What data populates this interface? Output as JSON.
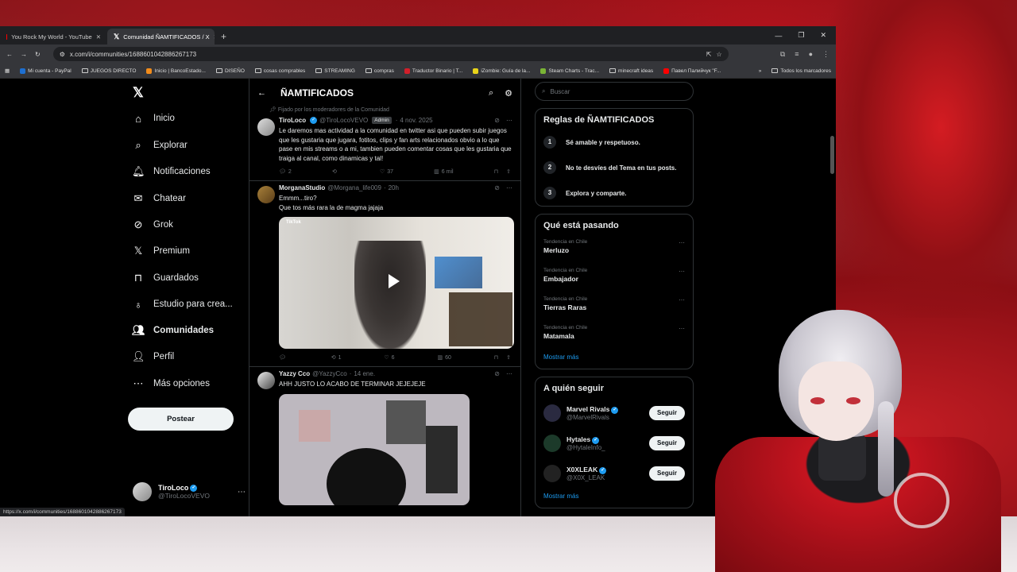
{
  "tabs": [
    {
      "label": "You Rock My World - YouTube",
      "icon": "youtube-icon"
    },
    {
      "label": "Comunidad ÑAMTIFICADOS / X",
      "icon": "x-icon"
    }
  ],
  "address": {
    "url": "x.com/i/communities/1688601042886267173"
  },
  "bookmarks": [
    {
      "label": "Mi cuenta - PayPal"
    },
    {
      "label": "JUEGOS DIRECTO"
    },
    {
      "label": "Inicio | BancoEstado..."
    },
    {
      "label": "DISEÑO"
    },
    {
      "label": "cosas comprables"
    },
    {
      "label": "compras"
    },
    {
      "label": "Traductor Binario | T..."
    },
    {
      "label": "STREAMING"
    },
    {
      "label": "iZombie: Guía de la..."
    },
    {
      "label": "Steam Charts - Trac..."
    },
    {
      "label": "minecraft ideas"
    },
    {
      "label": "Павел Палийчук \"F..."
    },
    {
      "label": "Todos los marcadores"
    }
  ],
  "nav": {
    "items": [
      {
        "label": "Inicio",
        "icon": "home-icon"
      },
      {
        "label": "Explorar",
        "icon": "search-icon"
      },
      {
        "label": "Notificaciones",
        "icon": "bell-icon"
      },
      {
        "label": "Chatear",
        "icon": "mail-icon"
      },
      {
        "label": "Grok",
        "icon": "grok-icon"
      },
      {
        "label": "Premium",
        "icon": "x-icon"
      },
      {
        "label": "Guardados",
        "icon": "bookmark-icon"
      },
      {
        "label": "Estudio para crea...",
        "icon": "studio-icon"
      },
      {
        "label": "Comunidades",
        "icon": "communities-icon"
      },
      {
        "label": "Perfil",
        "icon": "person-icon"
      },
      {
        "label": "Más opciones",
        "icon": "more-icon"
      }
    ],
    "post_label": "Postear",
    "user": {
      "name": "TiroLoco",
      "handle": "@TiroLocoVEVO"
    }
  },
  "community": {
    "title": "ÑAMTIFICADOS",
    "pinned_label": "Fijado por los moderadores de la Comunidad"
  },
  "tweets": [
    {
      "name": "TiroLoco",
      "handle": "@TiroLocoVEVO",
      "badge": "Admin",
      "time": "4 nov. 2025",
      "text": "Le daremos mas actividad a la comunidad en twitter asi que pueden subir juegos que les gustaria que jugara, fotitos, clips y fan arts relacionados obvio a lo que pase en mis streams o a mi, tambien pueden comentar cosas que les gustaria que traiga al canal, como dinamicas y tal!",
      "replies": "2",
      "reposts": "",
      "likes": "37",
      "views": "6 mil"
    },
    {
      "name": "MorganaStudio",
      "handle": "@Morgana_life009",
      "time": "20h",
      "text_line1": "Emmm...tiro?",
      "text_line2": "Que tos más rara la de magma jajaja",
      "media_label": "TikTok",
      "replies": "",
      "reposts": "1",
      "likes": "6",
      "views": "60"
    },
    {
      "name": "Yazzy Cco",
      "handle": "@YazzyCco",
      "time": "14 ene.",
      "text": "AHH JUSTO LO ACABO DE TERMINAR JEJEJEJE"
    }
  ],
  "search": {
    "placeholder": "Buscar"
  },
  "rules": {
    "title": "Reglas de ÑAMTIFICADOS",
    "items": [
      {
        "num": "1",
        "text": "Sé amable y respetuoso."
      },
      {
        "num": "2",
        "text": "No te desvíes del Tema en tus posts."
      },
      {
        "num": "3",
        "text": "Explora y comparte."
      }
    ]
  },
  "trends": {
    "title": "Qué está pasando",
    "items": [
      {
        "context": "Tendencia en Chile",
        "topic": "Merluzo"
      },
      {
        "context": "Tendencia en Chile",
        "topic": "Embajador"
      },
      {
        "context": "Tendencia en Chile",
        "topic": "Tierras Raras"
      },
      {
        "context": "Tendencia en Chile",
        "topic": "Matamala"
      }
    ],
    "more": "Mostrar más"
  },
  "follow": {
    "title": "A quién seguir",
    "items": [
      {
        "name": "Marvel Rivals",
        "handle": "@MarvelRivals",
        "button": "Seguir"
      },
      {
        "name": "Hytales",
        "handle": "@HytaleInfo_",
        "button": "Seguir"
      },
      {
        "name": "X0XLEAK",
        "handle": "@X0X_LEAK",
        "button": "Seguir"
      }
    ],
    "more": "Mostrar más"
  },
  "statusbar": {
    "url": "https://x.com/i/communities/1688601042886267173"
  }
}
